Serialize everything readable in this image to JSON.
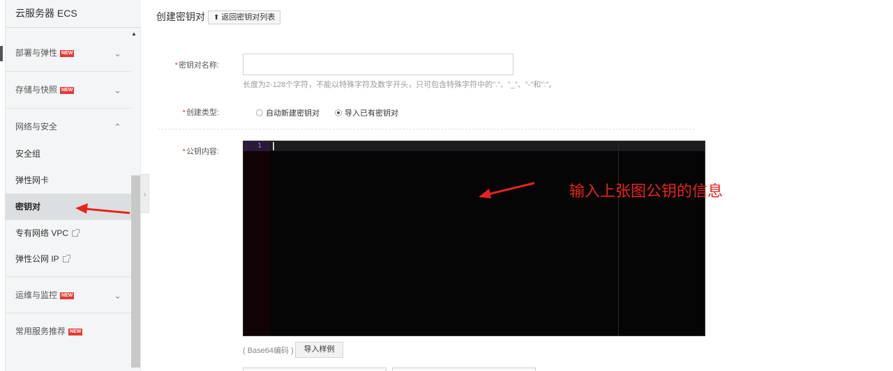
{
  "sidebar": {
    "title": "云服务器 ECS",
    "sections": [
      {
        "label": "部署与弹性",
        "badge": "NEW",
        "chevron": "﹀"
      },
      {
        "label": "存储与快照",
        "badge": "NEW",
        "chevron": "﹀"
      },
      {
        "label": "网络与安全",
        "badge": "",
        "chevron": "︿"
      }
    ],
    "items": [
      {
        "label": "安全组"
      },
      {
        "label": "弹性网卡"
      },
      {
        "label": "密钥对"
      },
      {
        "label": "专有网络 VPC"
      },
      {
        "label": "弹性公网 IP"
      }
    ],
    "bottom_sections": [
      {
        "label": "运维与监控",
        "badge": "NEW",
        "chevron": "﹀"
      },
      {
        "label": "常用服务推荐",
        "badge": "NEW"
      }
    ]
  },
  "header": {
    "title": "创建密钥对",
    "back_button": "返回密钥对列表"
  },
  "form": {
    "name_label": "密钥对名称:",
    "name_value": "",
    "name_hint": "长度为2-128个字符，不能以特殊字符及数字开头，只可包含特殊字符中的\".\"、\"_\"、\"-\"和\":\"。",
    "type_label": "创建类型:",
    "type_options": [
      "自动新建密钥对",
      "导入已有密钥对"
    ],
    "type_selected": "导入已有密钥对",
    "pubkey_label": "公钥内容:",
    "editor_line_number": "1",
    "encoding_note": "( Base64编码 )",
    "import_sample_button": "导入样例"
  },
  "annotation": {
    "text": "输入上张图公钥的信息",
    "color": "#e8231c"
  },
  "colors": {
    "new_badge": "#e53935",
    "editor_bg": "#050505",
    "required_star": "#e53935"
  }
}
